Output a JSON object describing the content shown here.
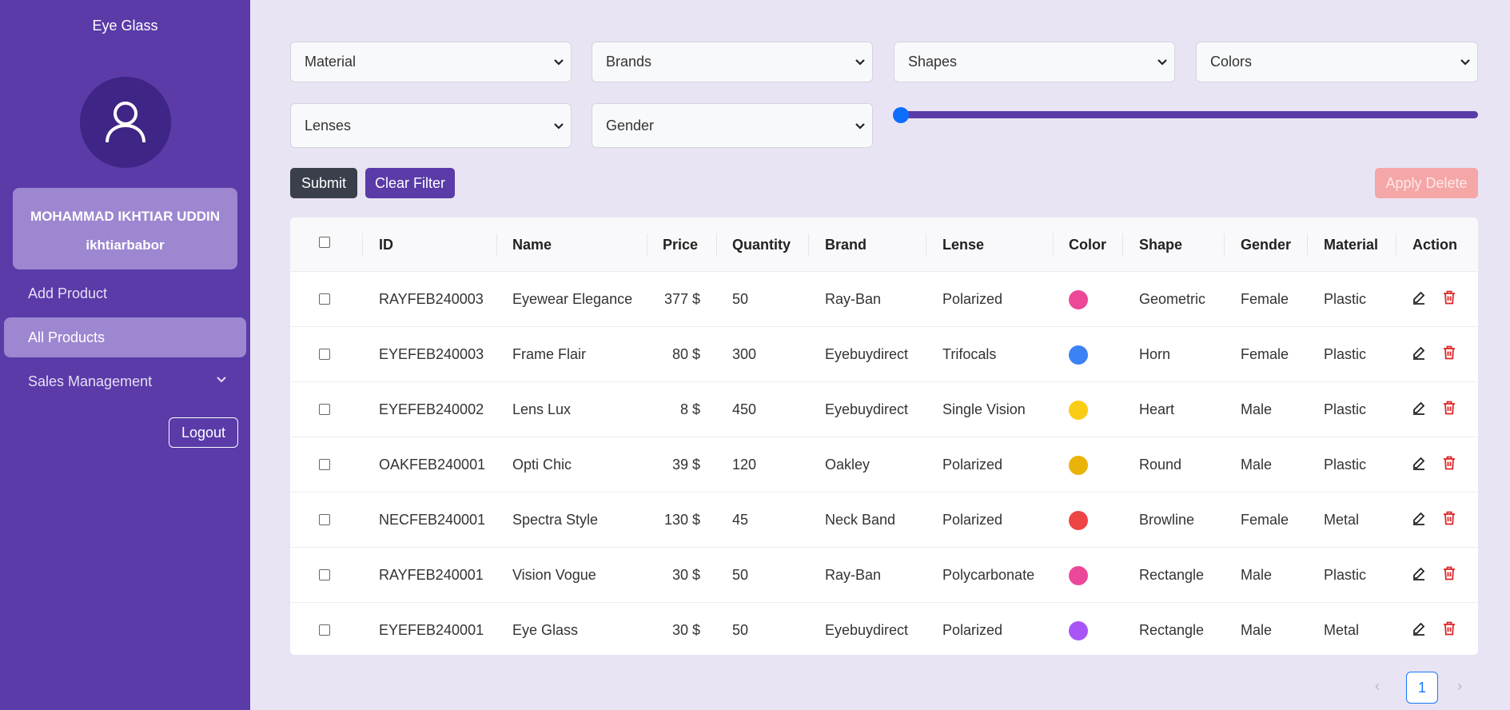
{
  "app": {
    "title": "Eye Glass"
  },
  "user": {
    "name": "MOHAMMAD IKHTIAR UDDIN",
    "handle": "ikhtiarbabor"
  },
  "sidebar": {
    "items": [
      {
        "label": "Add Product"
      },
      {
        "label": "All Products",
        "active": true
      },
      {
        "label": "Sales Management"
      }
    ],
    "logout": "Logout"
  },
  "filters": {
    "material": "Material",
    "brands": "Brands",
    "shapes": "Shapes",
    "colors": "Colors",
    "lenses": "Lenses",
    "gender": "Gender",
    "price_range_level": 0
  },
  "actions": {
    "submit": "Submit",
    "clear": "Clear Filter",
    "apply_delete": "Apply Delete"
  },
  "table": {
    "headers": {
      "id": "ID",
      "name": "Name",
      "price": "Price",
      "quantity": "Quantity",
      "brand": "Brand",
      "lense": "Lense",
      "color": "Color",
      "shape": "Shape",
      "gender": "Gender",
      "material": "Material",
      "action": "Action"
    },
    "rows": [
      {
        "id": "RAYFEB240003",
        "name": "Eyewear Elegance",
        "price": "377 $",
        "quantity": "50",
        "brand": "Ray-Ban",
        "lense": "Polarized",
        "color": "#ec4899",
        "shape": "Geometric",
        "gender": "Female",
        "material": "Plastic"
      },
      {
        "id": "EYEFEB240003",
        "name": "Frame Flair",
        "price": "80 $",
        "quantity": "300",
        "brand": "Eyebuydirect",
        "lense": "Trifocals",
        "color": "#3b82f6",
        "shape": "Horn",
        "gender": "Female",
        "material": "Plastic"
      },
      {
        "id": "EYEFEB240002",
        "name": "Lens Lux",
        "price": "8 $",
        "quantity": "450",
        "brand": "Eyebuydirect",
        "lense": "Single Vision",
        "color": "#facc15",
        "shape": "Heart",
        "gender": "Male",
        "material": "Plastic"
      },
      {
        "id": "OAKFEB240001",
        "name": "Opti Chic",
        "price": "39 $",
        "quantity": "120",
        "brand": "Oakley",
        "lense": "Polarized",
        "color": "#eab308",
        "shape": "Round",
        "gender": "Male",
        "material": "Plastic"
      },
      {
        "id": "NECFEB240001",
        "name": "Spectra Style",
        "price": "130 $",
        "quantity": "45",
        "brand": "Neck Band",
        "lense": "Polarized",
        "color": "#ef4444",
        "shape": "Browline",
        "gender": "Female",
        "material": "Metal"
      },
      {
        "id": "RAYFEB240001",
        "name": "Vision Vogue",
        "price": "30 $",
        "quantity": "50",
        "brand": "Ray-Ban",
        "lense": "Polycarbonate",
        "color": "#ec4899",
        "shape": "Rectangle",
        "gender": "Male",
        "material": "Plastic"
      },
      {
        "id": "EYEFEB240001",
        "name": "Eye Glass",
        "price": "30 $",
        "quantity": "50",
        "brand": "Eyebuydirect",
        "lense": "Polarized",
        "color": "#a855f7",
        "shape": "Rectangle",
        "gender": "Male",
        "material": "Metal"
      }
    ]
  },
  "pagination": {
    "prev": "‹",
    "current": "1",
    "next": "›"
  },
  "colors": {
    "sidebar": "#5a3ba8",
    "accent": "#5a3ba8",
    "background": "#e9e4f3",
    "danger": "#dc2626"
  },
  "icons": {
    "avatar": "user-icon",
    "edit": "edit-icon",
    "delete": "trash-icon",
    "select_caret": "chevron-down-icon"
  }
}
